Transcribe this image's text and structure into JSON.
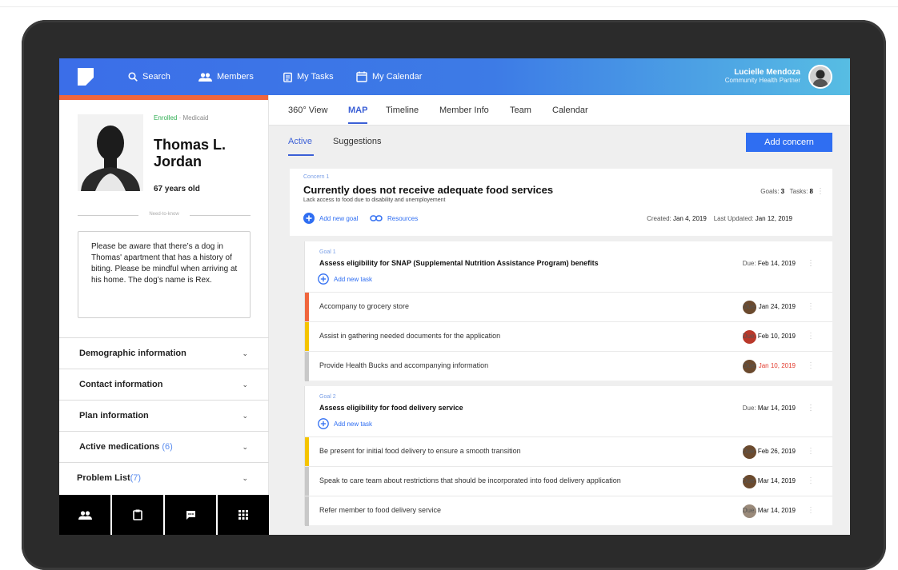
{
  "topbar": {
    "search": "Search",
    "members": "Members",
    "tasks": "My Tasks",
    "calendar": "My Calendar",
    "user_name": "Lucielle Mendoza",
    "user_role": "Community Health Partner"
  },
  "member": {
    "status_enrolled": "Enrolled",
    "status_plan": "· Medicaid",
    "name_line1": "Thomas L.",
    "name_line2": "Jordan",
    "age": "67 years old",
    "need_to_know_label": "Need-to-know",
    "note": "Please be aware that there’s a dog in Thomas' apartment that has a history of biting. Please be mindful when arriving at his home. The dog’s name is Rex."
  },
  "accordion": [
    {
      "label": "Demographic information",
      "count": ""
    },
    {
      "label": "Contact information",
      "count": ""
    },
    {
      "label": "Plan information",
      "count": ""
    },
    {
      "label": "Active medications",
      "count": "(6)"
    },
    {
      "label": "Problem List",
      "count": "(7)"
    }
  ],
  "bottom_tabs": [
    "people-icon",
    "clipboard-icon",
    "chat-icon",
    "apps-grid-icon"
  ],
  "tabs": [
    "360° View",
    "MAP",
    "Timeline",
    "Member Info",
    "Team",
    "Calendar"
  ],
  "active_tab": "MAP",
  "subtabs": [
    "Active",
    "Suggestions"
  ],
  "add_concern": "Add concern",
  "concern": {
    "label": "Concern 1",
    "title": "Currently does not receive adequate food services",
    "subtitle": "Lack access to food due to disability and unemployement",
    "goals_label": "Goals:",
    "goals": "3",
    "tasks_label": "Tasks:",
    "tasks": "8",
    "add_goal": "Add new goal",
    "resources": "Resources",
    "created_label": "Created:",
    "created": "Jan 4, 2019",
    "updated_label": "Last Updated:",
    "updated": "Jan 12, 2019"
  },
  "goals": [
    {
      "label": "Goal 1",
      "title": "Assess eligibility for SNAP (Supplemental Nutrition Assistance Program) benefits",
      "due": "Feb 14, 2019",
      "add_task": "Add new task",
      "tasks": [
        {
          "text": "Accompany to grocery store",
          "due": "Jan 24, 2019",
          "priority_color": "#f0663d",
          "overdue": false
        },
        {
          "text": "Assist in gathering needed documents for the application",
          "due": "Feb 10, 2019",
          "priority_color": "#f5c400",
          "overdue": false
        },
        {
          "text": "Provide Health Bucks and accompanying information",
          "due": "Jan 10, 2019",
          "priority_color": "#c8c8c8",
          "overdue": true
        }
      ]
    },
    {
      "label": "Goal 2",
      "title": "Assess eligibility for food delivery service",
      "due": "Mar 14, 2019",
      "add_task": "Add new task",
      "tasks": [
        {
          "text": "Be present for initial food delivery to ensure a smooth transition",
          "due": "Feb 26, 2019",
          "priority_color": "#f5c400",
          "overdue": false
        },
        {
          "text": "Speak to care team about restrictions that should be incorporated into food delivery application",
          "due": "Mar 14, 2019",
          "priority_color": "#c8c8c8",
          "overdue": false
        },
        {
          "text": "Refer member to food delivery service",
          "due": "Mar 14, 2019",
          "priority_color": "#c8c8c8",
          "overdue": false
        }
      ]
    }
  ],
  "due_prefix": "Due:"
}
